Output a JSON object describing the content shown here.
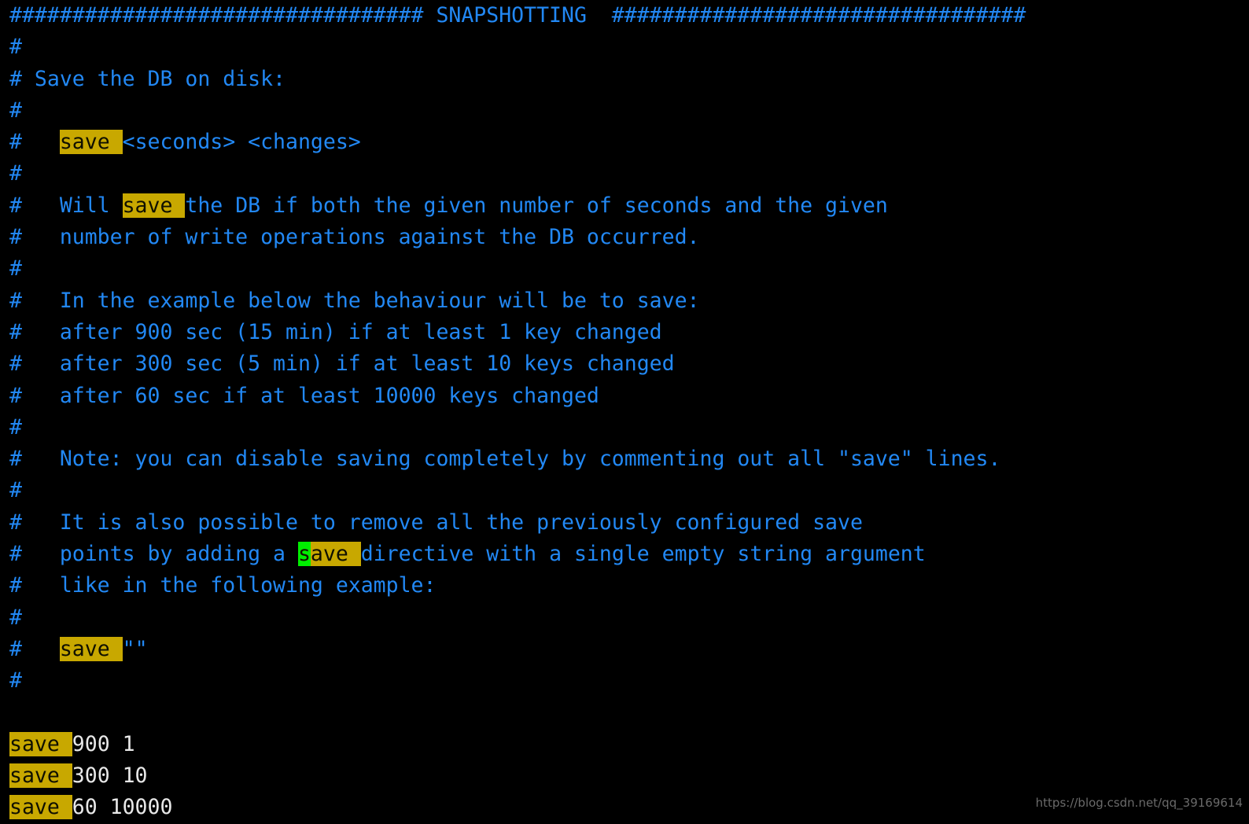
{
  "terminal": {
    "background": "#000000",
    "comment_color": "#2288f4",
    "text_color": "#e8e8e8",
    "search_highlight_color": "#c8a800",
    "current_match_color": "#00ee00",
    "font_size_px": 26.5,
    "line_height_px": 40.3,
    "search_pattern": "save ",
    "lines": [
      {
        "id": "l01",
        "segments": [
          {
            "style": "comment",
            "text": "################################# SNAPSHOTTING  #################################"
          }
        ]
      },
      {
        "id": "l02",
        "segments": [
          {
            "style": "comment",
            "text": "#"
          }
        ]
      },
      {
        "id": "l03",
        "segments": [
          {
            "style": "comment",
            "text": "# Save the DB on disk:"
          }
        ]
      },
      {
        "id": "l04",
        "segments": [
          {
            "style": "comment",
            "text": "#"
          }
        ]
      },
      {
        "id": "l05",
        "segments": [
          {
            "style": "comment",
            "text": "#   "
          },
          {
            "style": "hl",
            "text": "save "
          },
          {
            "style": "comment",
            "text": "<seconds> <changes>"
          }
        ]
      },
      {
        "id": "l06",
        "segments": [
          {
            "style": "comment",
            "text": "#"
          }
        ]
      },
      {
        "id": "l07",
        "segments": [
          {
            "style": "comment",
            "text": "#   Will "
          },
          {
            "style": "hl",
            "text": "save "
          },
          {
            "style": "comment",
            "text": "the DB if both the given number of seconds and the given"
          }
        ]
      },
      {
        "id": "l08",
        "segments": [
          {
            "style": "comment",
            "text": "#   number of write operations against the DB occurred."
          }
        ]
      },
      {
        "id": "l09",
        "segments": [
          {
            "style": "comment",
            "text": "#"
          }
        ]
      },
      {
        "id": "l10",
        "segments": [
          {
            "style": "comment",
            "text": "#   In the example below the behaviour will be to save:"
          }
        ]
      },
      {
        "id": "l11",
        "segments": [
          {
            "style": "comment",
            "text": "#   after 900 sec (15 min) if at least 1 key changed"
          }
        ]
      },
      {
        "id": "l12",
        "segments": [
          {
            "style": "comment",
            "text": "#   after 300 sec (5 min) if at least 10 keys changed"
          }
        ]
      },
      {
        "id": "l13",
        "segments": [
          {
            "style": "comment",
            "text": "#   after 60 sec if at least 10000 keys changed"
          }
        ]
      },
      {
        "id": "l14",
        "segments": [
          {
            "style": "comment",
            "text": "#"
          }
        ]
      },
      {
        "id": "l15",
        "segments": [
          {
            "style": "comment",
            "text": "#   Note: you can disable saving completely by commenting out all \"save\" lines."
          }
        ]
      },
      {
        "id": "l16",
        "segments": [
          {
            "style": "comment",
            "text": "#"
          }
        ]
      },
      {
        "id": "l17",
        "segments": [
          {
            "style": "comment",
            "text": "#   It is also possible to remove all the previously configured save"
          }
        ]
      },
      {
        "id": "l18",
        "segments": [
          {
            "style": "comment",
            "text": "#   points by adding a "
          },
          {
            "style": "hl-cur-char",
            "text": "s"
          },
          {
            "style": "hl-cur-rest",
            "text": "ave "
          },
          {
            "style": "comment",
            "text": "directive with a single empty string argument"
          }
        ]
      },
      {
        "id": "l19",
        "segments": [
          {
            "style": "comment",
            "text": "#   like in the following example:"
          }
        ]
      },
      {
        "id": "l20",
        "segments": [
          {
            "style": "comment",
            "text": "#"
          }
        ]
      },
      {
        "id": "l21",
        "segments": [
          {
            "style": "comment",
            "text": "#   "
          },
          {
            "style": "hl",
            "text": "save "
          },
          {
            "style": "comment",
            "text": "\"\""
          }
        ]
      },
      {
        "id": "l22",
        "segments": [
          {
            "style": "comment",
            "text": "#"
          }
        ]
      },
      {
        "id": "l23",
        "segments": [
          {
            "style": "blank",
            "text": " "
          }
        ]
      },
      {
        "id": "l24",
        "segments": [
          {
            "style": "hl",
            "text": "save "
          },
          {
            "style": "plain",
            "text": "900 1"
          }
        ]
      },
      {
        "id": "l25",
        "segments": [
          {
            "style": "hl",
            "text": "save "
          },
          {
            "style": "plain",
            "text": "300 10"
          }
        ]
      },
      {
        "id": "l26",
        "segments": [
          {
            "style": "hl",
            "text": "save "
          },
          {
            "style": "plain",
            "text": "60 10000"
          }
        ]
      }
    ]
  },
  "watermark": {
    "text": "https://blog.csdn.net/qq_39169614"
  }
}
